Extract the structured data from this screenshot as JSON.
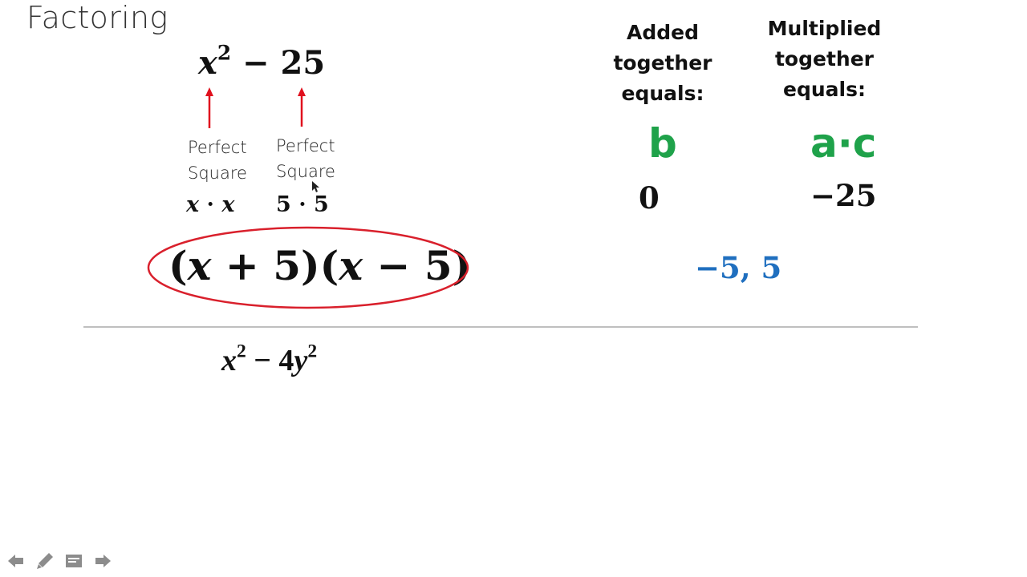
{
  "slide": {
    "title": "Factoring",
    "problem1": {
      "base": "x",
      "exponent": "2",
      "operator": " − ",
      "constant": "25",
      "labels": [
        "Perfect",
        "Square"
      ],
      "label_left_line1": "Perfect",
      "label_left_line2": "Square",
      "label_right_line1": "Perfect",
      "label_right_line2": "Square",
      "left_product": {
        "a": "x",
        "dot": " · ",
        "b": "x"
      },
      "right_product": {
        "a": "5",
        "dot": " · ",
        "b": "5"
      },
      "factored": {
        "p1": "(",
        "x1": "x",
        "mid1": " + 5)(",
        "x2": "x",
        "mid2": " − 5)"
      }
    },
    "table": {
      "added_header": [
        "Added",
        "together",
        "equals:"
      ],
      "multiplied_header": [
        "Multiplied",
        "together",
        "equals:"
      ],
      "b_label": "b",
      "ac_label": "a·c",
      "b_value": "0",
      "ac_value": "−25",
      "pair": "−5, 5"
    },
    "problem2": {
      "base1": "x",
      "exp1": "2",
      "operator": " − 4",
      "base2": "y",
      "exp2": "2"
    },
    "colors": {
      "arrow": "#e0101e",
      "ellipse": "#d9202c",
      "green": "#1fa24a",
      "blue": "#1f6fbf",
      "divider": "#bfbfbf",
      "nav_icons": "#8c8c8c"
    }
  },
  "nav": {
    "icons": [
      "arrow-left-icon",
      "pen-icon",
      "notes-icon",
      "arrow-right-icon"
    ]
  }
}
